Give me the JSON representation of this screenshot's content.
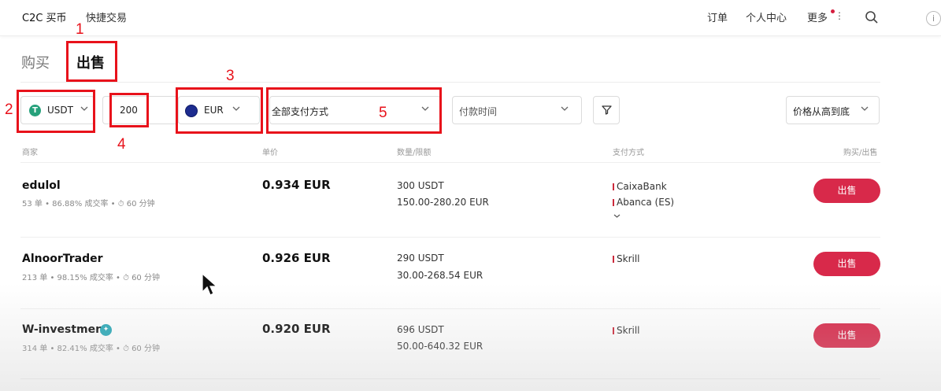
{
  "topbar": {
    "c2c_buy": "C2C 买币",
    "quick_trade": "快捷交易",
    "orders": "订单",
    "user_center": "个人中心",
    "more": "更多",
    "info": "i"
  },
  "tabs": {
    "buy": "购买",
    "sell": "出售"
  },
  "filters": {
    "crypto": "USDT",
    "amount": "200",
    "fiat": "EUR",
    "payment": "全部支付方式",
    "pay_time": "付款时间",
    "sort": "价格从高到底"
  },
  "columns": {
    "merchant": "商家",
    "price": "单价",
    "qty_limit": "数量/限额",
    "payment": "支付方式",
    "action": "购买/出售"
  },
  "rows": [
    {
      "merchant": "edulol",
      "stats": "53 单  •  86.88% 成交率  •  ⏱ 60 分钟",
      "price": "0.934 EUR",
      "quantity": "300 USDT",
      "limit": "150.00-280.20 EUR",
      "payments": [
        "CaixaBank",
        "Abanca (ES)"
      ],
      "button": "出售"
    },
    {
      "merchant": "AlnoorTrader",
      "stats": "213 单  •  98.15% 成交率  •  ⏱ 60 分钟",
      "price": "0.926 EUR",
      "quantity": "290 USDT",
      "limit": "30.00-268.54 EUR",
      "payments": [
        "Skrill"
      ],
      "button": "出售"
    },
    {
      "merchant": "W-investment",
      "stats": "314 单  •  82.41% 成交率  •  ⏱ 60 分钟",
      "price": "0.920 EUR",
      "quantity": "696 USDT",
      "limit": "50.00-640.32 EUR",
      "payments": [
        "Skrill"
      ],
      "button": "出售"
    }
  ],
  "annotations": [
    "1",
    "2",
    "3",
    "4",
    "5"
  ],
  "colors": {
    "accent": "#d8294a",
    "annotation": "#e8121b",
    "usdt": "#26a17b"
  }
}
